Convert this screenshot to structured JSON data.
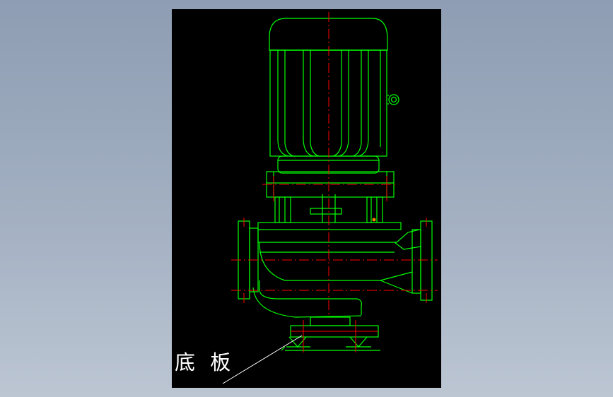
{
  "drawing": {
    "label": "底 板",
    "colors": {
      "outline": "#00ff00",
      "centerline": "#ff0000",
      "leader": "#ffffff",
      "background": "#000000",
      "paper": "#9aa7bb",
      "marker": "#ff8000"
    }
  }
}
